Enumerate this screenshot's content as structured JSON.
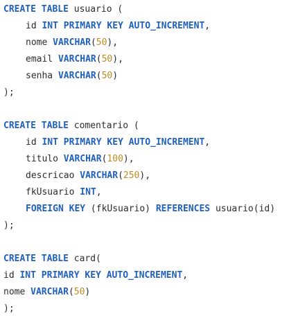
{
  "colors": {
    "keyword": "#1f5fbf",
    "number": "#c08a1e",
    "text": "#2b2b2b",
    "background": "#ffffff"
  },
  "code": {
    "lines": [
      [
        {
          "t": "kw",
          "v": "CREATE TABLE"
        },
        {
          "t": "txt",
          "v": " usuario ("
        }
      ],
      [
        {
          "t": "indent"
        },
        {
          "t": "txt",
          "v": "id "
        },
        {
          "t": "kw",
          "v": "INT PRIMARY KEY AUTO_INCREMENT"
        },
        {
          "t": "txt",
          "v": ","
        }
      ],
      [
        {
          "t": "indent"
        },
        {
          "t": "txt",
          "v": "nome "
        },
        {
          "t": "kw",
          "v": "VARCHAR"
        },
        {
          "t": "txt",
          "v": "("
        },
        {
          "t": "num",
          "v": "50"
        },
        {
          "t": "txt",
          "v": "),"
        }
      ],
      [
        {
          "t": "indent"
        },
        {
          "t": "txt",
          "v": "email "
        },
        {
          "t": "kw",
          "v": "VARCHAR"
        },
        {
          "t": "txt",
          "v": "("
        },
        {
          "t": "num",
          "v": "50"
        },
        {
          "t": "txt",
          "v": "),"
        }
      ],
      [
        {
          "t": "indent"
        },
        {
          "t": "txt",
          "v": "senha "
        },
        {
          "t": "kw",
          "v": "VARCHAR"
        },
        {
          "t": "txt",
          "v": "("
        },
        {
          "t": "num",
          "v": "50"
        },
        {
          "t": "txt",
          "v": ")"
        }
      ],
      [
        {
          "t": "txt",
          "v": ");"
        }
      ],
      [],
      [
        {
          "t": "kw",
          "v": "CREATE TABLE"
        },
        {
          "t": "txt",
          "v": " comentario ("
        }
      ],
      [
        {
          "t": "indent"
        },
        {
          "t": "txt",
          "v": "id "
        },
        {
          "t": "kw",
          "v": "INT PRIMARY KEY AUTO_INCREMENT"
        },
        {
          "t": "txt",
          "v": ","
        }
      ],
      [
        {
          "t": "indent"
        },
        {
          "t": "txt",
          "v": "titulo "
        },
        {
          "t": "kw",
          "v": "VARCHAR"
        },
        {
          "t": "txt",
          "v": "("
        },
        {
          "t": "num",
          "v": "100"
        },
        {
          "t": "txt",
          "v": "),"
        }
      ],
      [
        {
          "t": "indent"
        },
        {
          "t": "txt",
          "v": "descricao "
        },
        {
          "t": "kw",
          "v": "VARCHAR"
        },
        {
          "t": "txt",
          "v": "("
        },
        {
          "t": "num",
          "v": "250"
        },
        {
          "t": "txt",
          "v": "),"
        }
      ],
      [
        {
          "t": "indent"
        },
        {
          "t": "txt",
          "v": "fkUsuario "
        },
        {
          "t": "kw",
          "v": "INT"
        },
        {
          "t": "txt",
          "v": ","
        }
      ],
      [
        {
          "t": "indent"
        },
        {
          "t": "kw",
          "v": "FOREIGN KEY"
        },
        {
          "t": "txt",
          "v": " (fkUsuario) "
        },
        {
          "t": "kw",
          "v": "REFERENCES"
        },
        {
          "t": "txt",
          "v": " usuario(id)"
        }
      ],
      [
        {
          "t": "txt",
          "v": ");"
        }
      ],
      [],
      [
        {
          "t": "kw",
          "v": "CREATE TABLE"
        },
        {
          "t": "txt",
          "v": " card("
        }
      ],
      [
        {
          "t": "txt",
          "v": "id "
        },
        {
          "t": "kw",
          "v": "INT PRIMARY KEY AUTO_INCREMENT"
        },
        {
          "t": "txt",
          "v": ","
        }
      ],
      [
        {
          "t": "txt",
          "v": "nome "
        },
        {
          "t": "kw",
          "v": "VARCHAR"
        },
        {
          "t": "txt",
          "v": "("
        },
        {
          "t": "num",
          "v": "50"
        },
        {
          "t": "txt",
          "v": ")"
        }
      ],
      [
        {
          "t": "txt",
          "v": ");"
        }
      ]
    ]
  }
}
